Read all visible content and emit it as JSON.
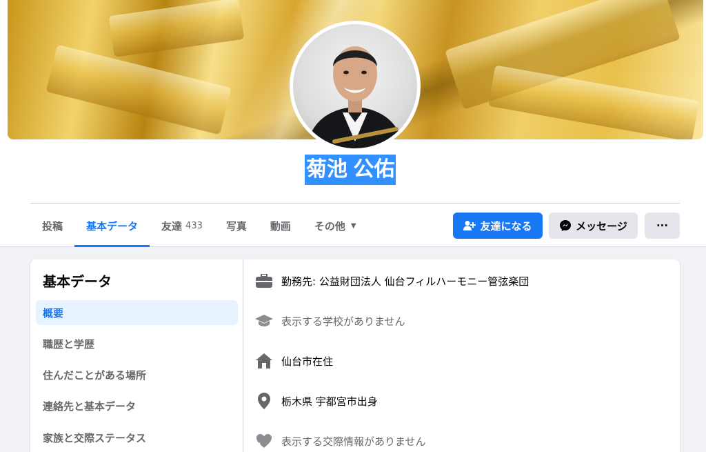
{
  "profile": {
    "name": "菊池 公佑"
  },
  "tabs": [
    {
      "label": "投稿"
    },
    {
      "label": "基本データ"
    },
    {
      "label": "友達",
      "count": "433"
    },
    {
      "label": "写真"
    },
    {
      "label": "動画"
    },
    {
      "label": "その他"
    }
  ],
  "actions": {
    "add_friend": "友達になる",
    "message": "メッセージ",
    "more": "···"
  },
  "about": {
    "title": "基本データ",
    "nav": [
      {
        "label": "概要"
      },
      {
        "label": "職歴と学歴"
      },
      {
        "label": "住んだことがある場所"
      },
      {
        "label": "連絡先と基本データ"
      },
      {
        "label": "家族と交際ステータス"
      }
    ],
    "rows": [
      {
        "text": "勤務先: 公益財団法人 仙台フィルハーモニー管弦楽団",
        "icon": "briefcase-icon"
      },
      {
        "text": "表示する学校がありません",
        "icon": "graduation-cap-icon"
      },
      {
        "text": "仙台市在住",
        "icon": "home-icon"
      },
      {
        "text": "栃木県 宇都宮市出身",
        "icon": "location-pin-icon"
      },
      {
        "text": "表示する交際情報がありません",
        "icon": "heart-icon"
      }
    ]
  },
  "colors": {
    "accent": "#1877f2",
    "background": "#f0f2f5",
    "selection": "#3390ff"
  }
}
